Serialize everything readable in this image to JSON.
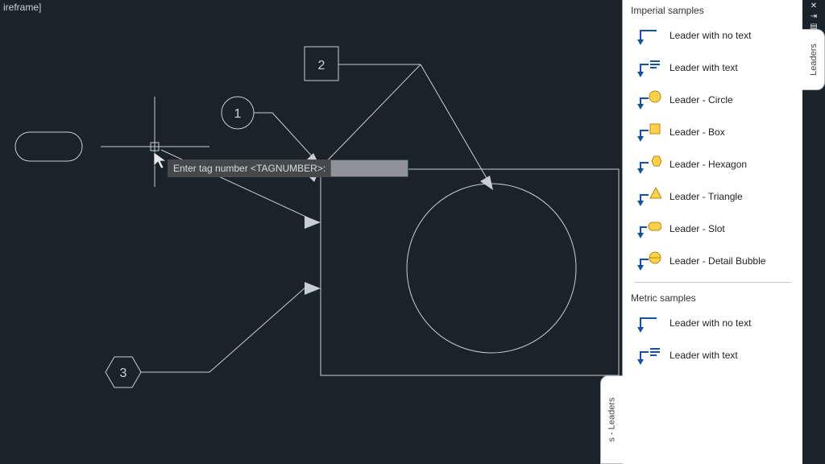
{
  "viewport_label": "ireframe]",
  "prompt": {
    "text": "Enter tag number <TAGNUMBER>:"
  },
  "tags": {
    "one": "1",
    "two": "2",
    "three": "3"
  },
  "palette": {
    "tab_label": "Leaders",
    "secondary_tab_label": "s - Leaders",
    "imperial_header": "Imperial samples",
    "metric_header": "Metric samples",
    "items_imperial": [
      {
        "label": "Leader with no text"
      },
      {
        "label": "Leader with text"
      },
      {
        "label": "Leader - Circle"
      },
      {
        "label": "Leader - Box"
      },
      {
        "label": "Leader - Hexagon"
      },
      {
        "label": "Leader - Triangle"
      },
      {
        "label": "Leader - Slot"
      },
      {
        "label": "Leader - Detail Bubble"
      }
    ],
    "items_metric": [
      {
        "label": "Leader with no text"
      },
      {
        "label": "Leader with text"
      }
    ]
  }
}
